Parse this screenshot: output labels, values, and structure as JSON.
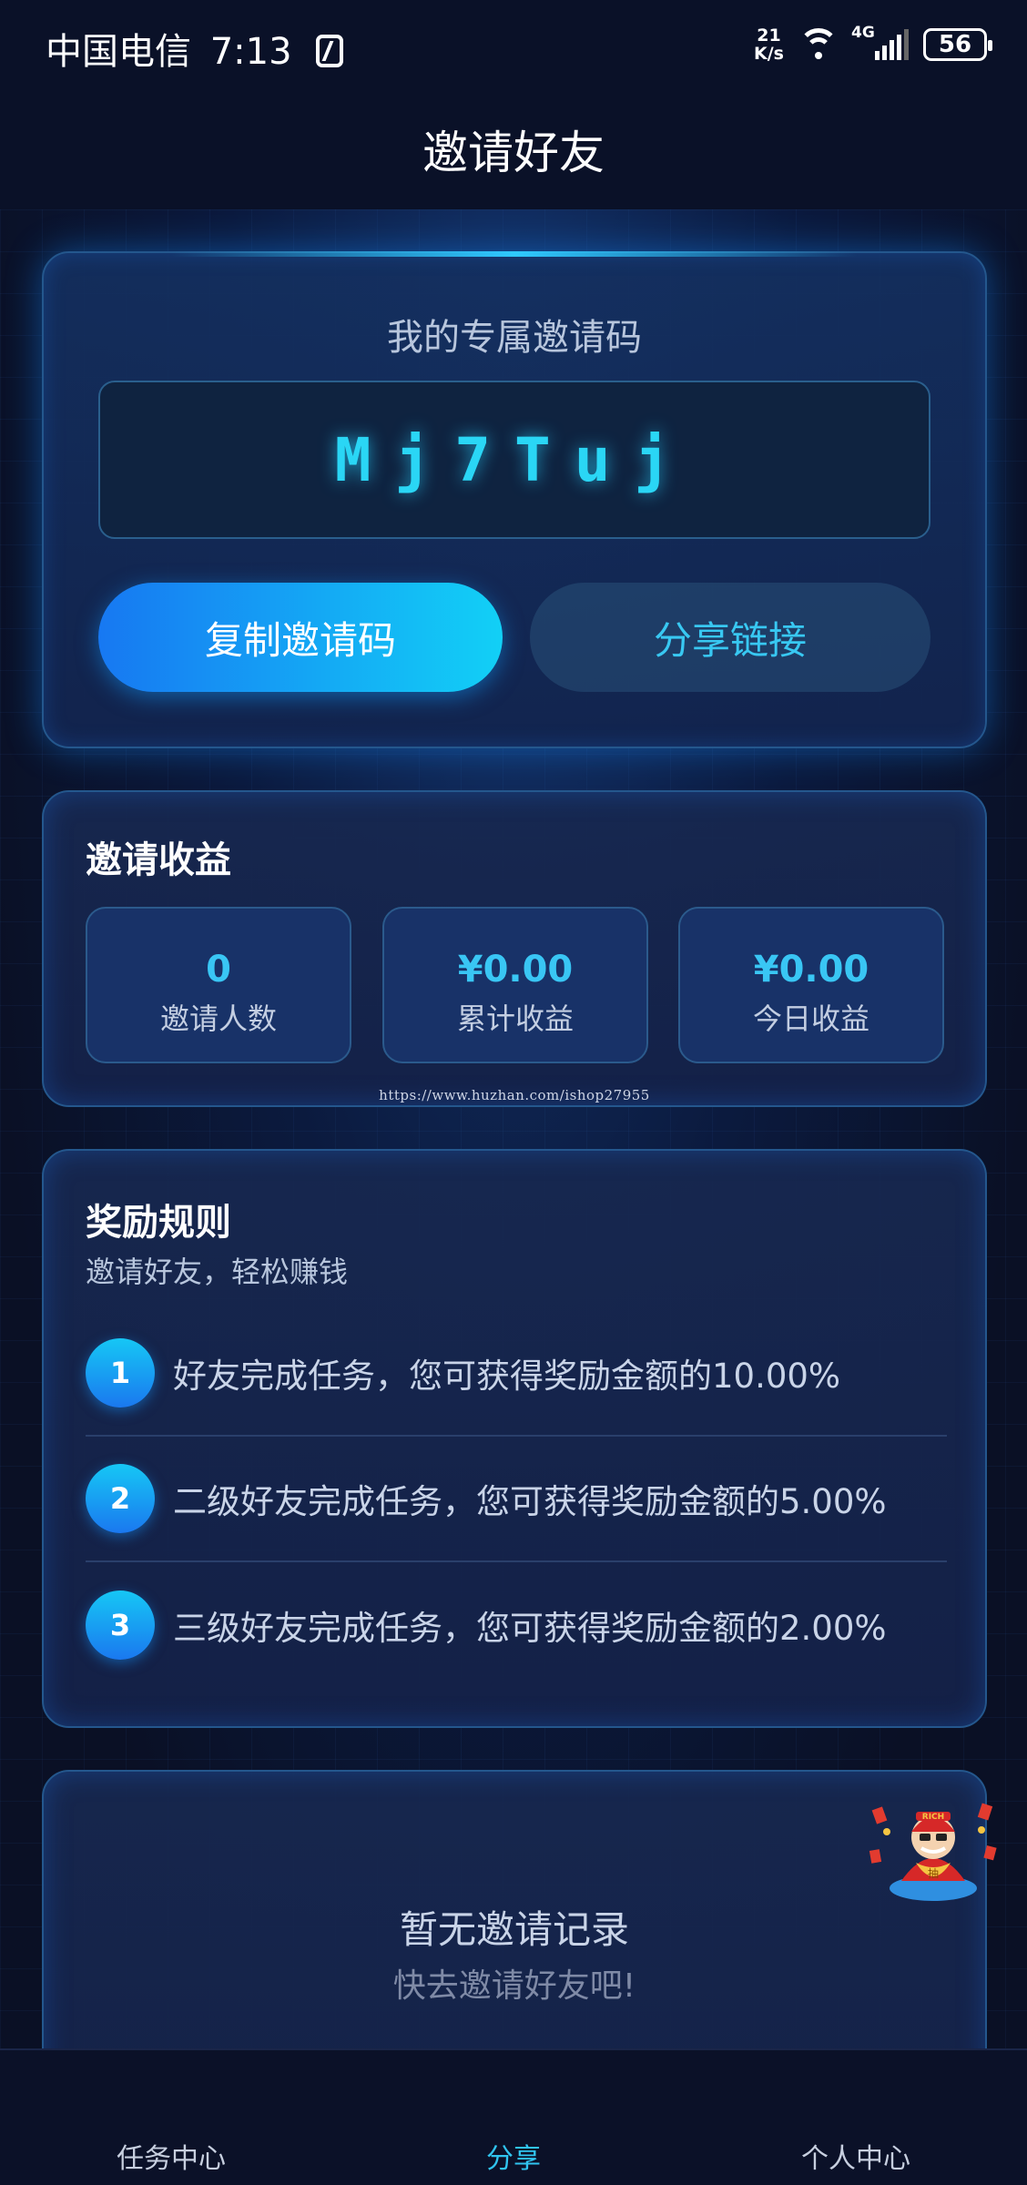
{
  "status_bar": {
    "carrier": "中国电信",
    "time": "7:13",
    "net_speed_value": "21",
    "net_speed_unit": "K/s",
    "network": "4G",
    "battery": "56"
  },
  "header": {
    "title": "邀请好友"
  },
  "invite": {
    "title": "我的专属邀请码",
    "code": "Mj7Tuj",
    "copy_label": "复制邀请码",
    "share_label": "分享链接"
  },
  "earnings": {
    "title": "邀请收益",
    "stats": [
      {
        "value": "0",
        "label": "邀请人数"
      },
      {
        "value": "¥0.00",
        "label": "累计收益"
      },
      {
        "value": "¥0.00",
        "label": "今日收益"
      }
    ],
    "watermark": "https://www.huzhan.com/ishop27955"
  },
  "rules": {
    "title": "奖励规则",
    "subtitle": "邀请好友，轻松赚钱",
    "items": [
      {
        "num": "1",
        "text": "好友完成任务，您可获得奖励金额的10.00%"
      },
      {
        "num": "2",
        "text": "二级好友完成任务，您可获得奖励金额的5.00%"
      },
      {
        "num": "3",
        "text": "三级好友完成任务，您可获得奖励金额的2.00%"
      }
    ]
  },
  "records": {
    "empty_title": "暂无邀请记录",
    "empty_subtitle": "快去邀请好友吧!"
  },
  "mascot": {
    "badge_text": "RICH",
    "belly_text": "抽"
  },
  "tabbar": {
    "items": [
      {
        "label": "任务中心"
      },
      {
        "label": "分享"
      },
      {
        "label": "个人中心"
      }
    ],
    "active": "分享"
  },
  "colors": {
    "accent": "#30c4ef",
    "button_gradient_start": "#1778f2",
    "button_gradient_end": "#12d0f6",
    "background": "#0a1025"
  }
}
